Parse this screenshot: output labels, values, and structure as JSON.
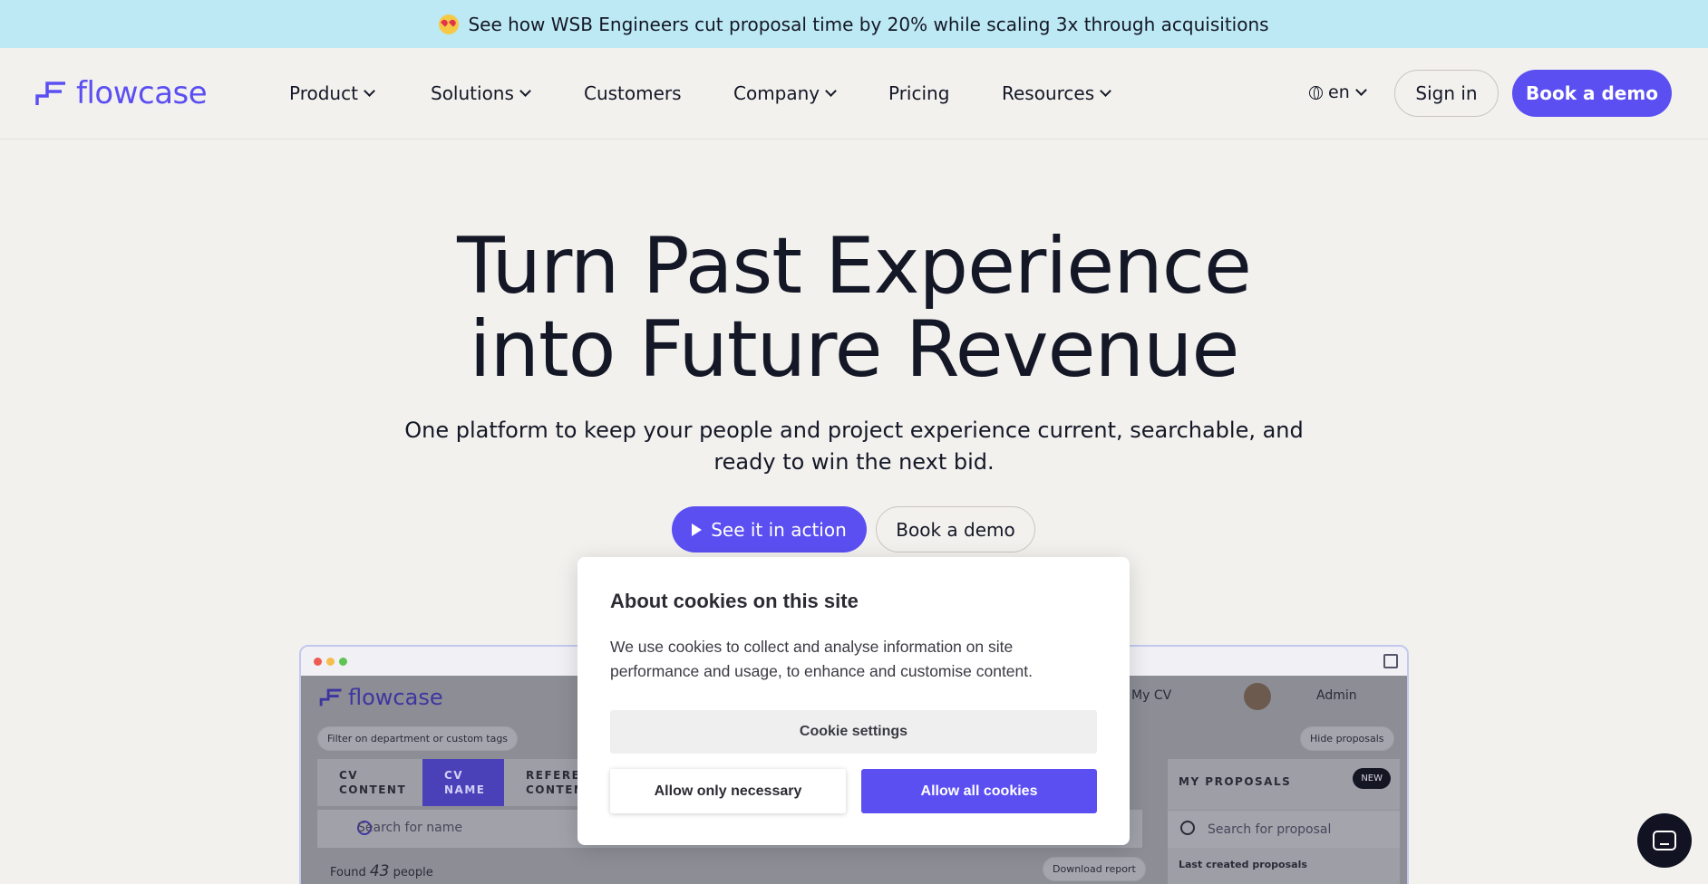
{
  "banner": {
    "text": "See how WSB Engineers cut proposal time by 20% while scaling 3x through acquisitions",
    "emoji": "heart-eyes-emoji"
  },
  "nav": {
    "logo": "flowcase",
    "items": [
      "Product",
      "Solutions",
      "Customers",
      "Company",
      "Pricing",
      "Resources"
    ],
    "lang": "en",
    "sign_in": "Sign in",
    "book_demo": "Book a demo"
  },
  "hero": {
    "title_line1": "Turn Past Experience",
    "title_line2": "into Future Revenue",
    "subtitle": "One platform to keep your people and project experience current, searchable, and ready to win the next bid.",
    "see_action": "See it in action",
    "book_demo": "Book a demo"
  },
  "mockup": {
    "logo": "flowcase",
    "my_cv": "My CV",
    "admin": "Admin",
    "filter": "Filter on department or custom tags",
    "hide_proposals": "Hide proposals",
    "tabs": [
      {
        "line1": "CV",
        "line2": "CONTENT"
      },
      {
        "line1": "CV",
        "line2": "NAME"
      },
      {
        "line1": "REFERE",
        "line2": "CONTEN"
      }
    ],
    "search_placeholder": "Search for name",
    "found_prefix": "Found",
    "found_count": "43",
    "found_suffix": "people",
    "download_report": "Download report",
    "my_proposals": "MY PROPOSALS",
    "new_badge": "NEW",
    "search_proposal": "Search for proposal",
    "last_created": "Last created proposals"
  },
  "cookie": {
    "title": "About cookies on this site",
    "body": "We use cookies to collect and analyse information on site performance and usage, to enhance and customise content.",
    "settings": "Cookie settings",
    "necessary": "Allow only necessary",
    "allow_all": "Allow all cookies"
  },
  "colors": {
    "accent": "#5b4ff2",
    "banner": "#bde9f5",
    "background": "#f2f1ee"
  }
}
